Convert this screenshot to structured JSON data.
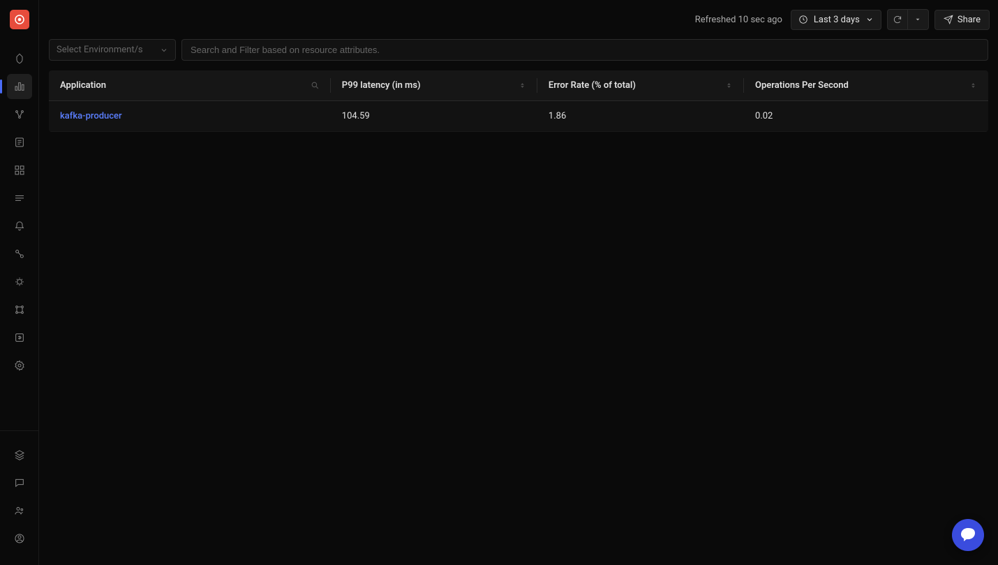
{
  "toolbar": {
    "refreshed_text": "Refreshed 10 sec ago",
    "time_range": "Last 3 days",
    "share_label": "Share"
  },
  "filters": {
    "env_placeholder": "Select Environment/s",
    "search_placeholder": "Search and Filter based on resource attributes."
  },
  "table": {
    "headers": {
      "application": "Application",
      "p99": "P99 latency (in ms)",
      "error_rate": "Error Rate (% of total)",
      "ops": "Operations Per Second"
    },
    "rows": [
      {
        "application": "kafka-producer",
        "p99": "104.59",
        "error_rate": "1.86",
        "ops": "0.02"
      }
    ]
  }
}
